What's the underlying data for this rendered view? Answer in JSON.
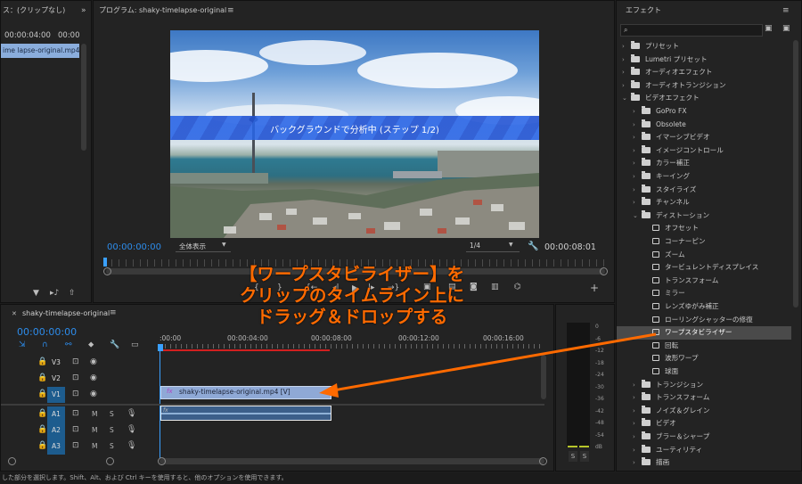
{
  "source_panel": {
    "title": "ス：(クリップなし)",
    "timecode_left": "00:00:04:00",
    "timecode_right": "00:00",
    "clip_name": "ime lapse-original.mp4"
  },
  "program": {
    "title": "プログラム: shaky-timelapse-original",
    "overlay_text": "バックグラウンドで分析中 (ステップ 1/2)",
    "timecode_current": "00:00:00:00",
    "fit_label": "全体表示",
    "resolution_label": "1/4",
    "timecode_duration": "00:00:08:01"
  },
  "timeline": {
    "tab_title": "shaky-timelapse-original",
    "timecode": "00:00:00:00",
    "ruler_labels": [
      ":00:00",
      "00:00:04:00",
      "00:00:08:00",
      "00:00:12:00",
      "00:00:16:00"
    ],
    "video_tracks": [
      "V3",
      "V2",
      "V1"
    ],
    "audio_tracks": [
      "A1",
      "A2",
      "A3"
    ],
    "track_toggles": {
      "mute": "M",
      "solo": "S"
    },
    "video_clip": {
      "label": "shaky-timelapse-original.mp4 [V]",
      "fx": "fx"
    },
    "audio_clip": {
      "fx": "fx"
    }
  },
  "meter": {
    "scale": [
      "0",
      "-6",
      "-12",
      "-18",
      "-24",
      "-30",
      "-36",
      "-42",
      "-48",
      "-54",
      "dB"
    ],
    "solo_buttons": [
      "S",
      "S"
    ]
  },
  "effects": {
    "title": "エフェクト",
    "search_value": "",
    "tree": [
      {
        "label": "プリセット",
        "depth": 0,
        "kind": "folder"
      },
      {
        "label": "Lumetri プリセット",
        "depth": 0,
        "kind": "folder"
      },
      {
        "label": "オーディオエフェクト",
        "depth": 0,
        "kind": "folder"
      },
      {
        "label": "オーディオトランジション",
        "depth": 0,
        "kind": "folder"
      },
      {
        "label": "ビデオエフェクト",
        "depth": 0,
        "kind": "folder",
        "open": true
      },
      {
        "label": "GoPro FX",
        "depth": 1,
        "kind": "folder"
      },
      {
        "label": "Obsolete",
        "depth": 1,
        "kind": "folder"
      },
      {
        "label": "イマーシブビデオ",
        "depth": 1,
        "kind": "folder"
      },
      {
        "label": "イメージコントロール",
        "depth": 1,
        "kind": "folder"
      },
      {
        "label": "カラー補正",
        "depth": 1,
        "kind": "folder"
      },
      {
        "label": "キーイング",
        "depth": 1,
        "kind": "folder"
      },
      {
        "label": "スタイライズ",
        "depth": 1,
        "kind": "folder"
      },
      {
        "label": "チャンネル",
        "depth": 1,
        "kind": "folder"
      },
      {
        "label": "ディストーション",
        "depth": 1,
        "kind": "folder",
        "open": true
      },
      {
        "label": "オフセット",
        "depth": 2,
        "kind": "effect"
      },
      {
        "label": "コーナーピン",
        "depth": 2,
        "kind": "effect"
      },
      {
        "label": "ズーム",
        "depth": 2,
        "kind": "effect"
      },
      {
        "label": "タービュレントディスプレイス",
        "depth": 2,
        "kind": "effect"
      },
      {
        "label": "トランスフォーム",
        "depth": 2,
        "kind": "effect"
      },
      {
        "label": "ミラー",
        "depth": 2,
        "kind": "effect"
      },
      {
        "label": "レンズゆがみ補正",
        "depth": 2,
        "kind": "effect"
      },
      {
        "label": "ローリングシャッターの修復",
        "depth": 2,
        "kind": "effect"
      },
      {
        "label": "ワープスタビライザー",
        "depth": 2,
        "kind": "effect",
        "selected": true
      },
      {
        "label": "回転",
        "depth": 2,
        "kind": "effect"
      },
      {
        "label": "波形ワープ",
        "depth": 2,
        "kind": "effect"
      },
      {
        "label": "球面",
        "depth": 2,
        "kind": "effect"
      },
      {
        "label": "トランジション",
        "depth": 1,
        "kind": "folder"
      },
      {
        "label": "トランスフォーム",
        "depth": 1,
        "kind": "folder"
      },
      {
        "label": "ノイズ＆グレイン",
        "depth": 1,
        "kind": "folder"
      },
      {
        "label": "ビデオ",
        "depth": 1,
        "kind": "folder"
      },
      {
        "label": "ブラー＆シャープ",
        "depth": 1,
        "kind": "folder"
      },
      {
        "label": "ユーティリティ",
        "depth": 1,
        "kind": "folder"
      },
      {
        "label": "描画",
        "depth": 1,
        "kind": "folder"
      }
    ]
  },
  "annotation": {
    "lines": [
      "【ワープスタビライザー】を",
      "クリップのタイムライン上に",
      "ドラッグ＆ドロップする"
    ]
  },
  "status_bar": {
    "text": "した部分を選択します。Shift、Alt、および Ctrl キーを使用すると、他のオプションを使用できます。"
  },
  "colors": {
    "accent_blue": "#2d8ceb",
    "annotation_orange": "#ff6a00",
    "playhead_blue": "#3aa0ff",
    "track_select": "#1d5c8e",
    "clip_blue": "#8fa9d6"
  }
}
